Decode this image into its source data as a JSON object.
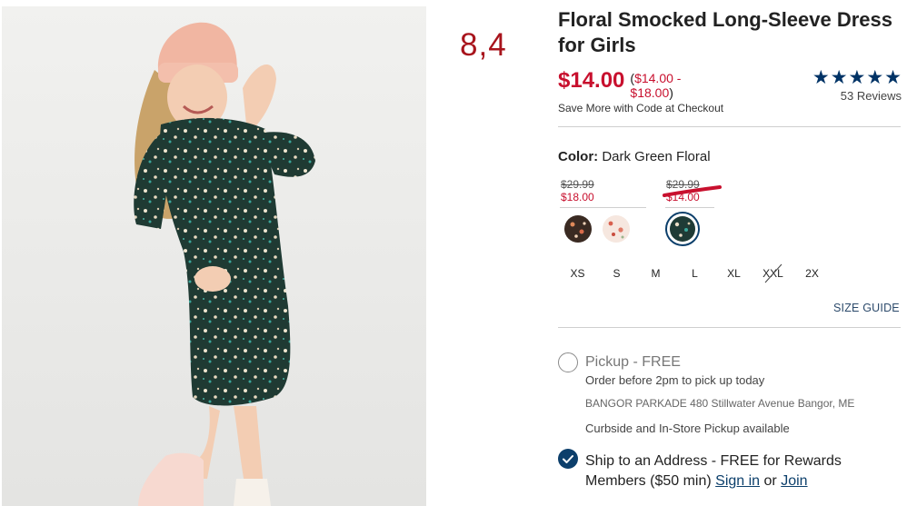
{
  "annotation": {
    "number": "8,4"
  },
  "product": {
    "title": "Floral Smocked Long-Sleeve Dress for Girls",
    "price_now": "$14.00",
    "price_range_low": "$14.00 -",
    "price_range_high": "$18.00",
    "promo": "Save More with Code at Checkout"
  },
  "rating": {
    "stars": 5,
    "reviews": "53 Reviews"
  },
  "color": {
    "label": "Color:",
    "value": "Dark Green Floral"
  },
  "price_tiers": [
    {
      "was": "$29.99",
      "now": "$18.00"
    },
    {
      "was": "$29.99",
      "now": "$14.00"
    }
  ],
  "swatches": [
    {
      "name": "black-floral",
      "color": "#3a2a22"
    },
    {
      "name": "cream-floral",
      "color": "#f3e2da"
    },
    {
      "name": "dark-green-floral",
      "color": "#1f3b36",
      "selected": true
    }
  ],
  "sizes": [
    "XS",
    "S",
    "M",
    "L",
    "XL",
    "XXL",
    "2X"
  ],
  "size_guide": "SIZE GUIDE",
  "pickup": {
    "title": "Pickup - FREE",
    "subtitle": "Order before 2pm to pick up today",
    "store_name": "BANGOR PARKADE",
    "store_address": "480 Stillwater Avenue",
    "store_city": "Bangor, ME",
    "curbside": "Curbside and In-Store Pickup available"
  },
  "ship": {
    "text": "Ship to an Address - FREE for Rewards Members ($50 min)",
    "sign_in": "Sign in",
    "or": "or",
    "join": "Join"
  },
  "colors": {
    "brand_navy": "#0c3f6b",
    "sale_red": "#c8102e"
  }
}
